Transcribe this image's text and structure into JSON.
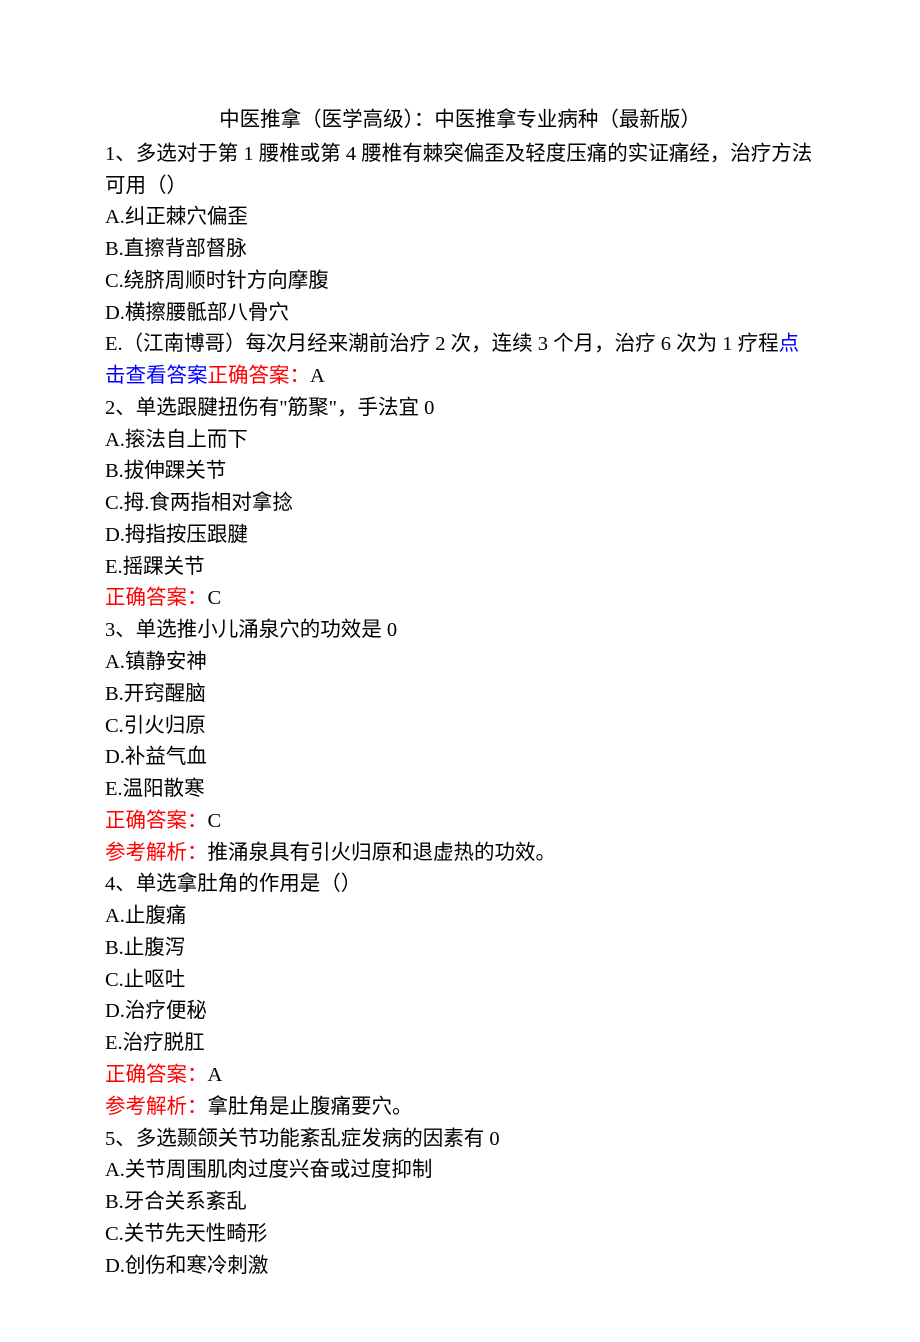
{
  "title": "中医推拿（医学高级）：中医推拿专业病种（最新版）",
  "questions": [
    {
      "stem_prefix": "1、多选",
      "stem_rest": "对于第 1 腰椎或第 4 腰椎有棘突偏歪及轻度压痛的实证痛经，治疗方法可用（）",
      "options": [
        "A.纠正棘穴偏歪",
        "B.直擦背部督脉",
        "C.绕脐周顺时针方向摩腹",
        "D.横擦腰骶部八骨穴"
      ],
      "option_e_prefix": "E.（江南博哥）每次月经来潮前治疗 2 次，连续 3 个月，治疗 6 次为 1 疗程",
      "click_label": "点击查看答案",
      "answer_label": "正确答案：",
      "answer_value": "A"
    },
    {
      "stem_prefix": "2、单选",
      "stem_rest": "跟腱扭伤有\"筋聚\"，手法宜 0",
      "options": [
        "A.㨰法自上而下",
        "B.拔伸踝关节",
        "C.拇.食两指相对拿捻",
        "D.拇指按压跟腱",
        "E.摇踝关节"
      ],
      "answer_label": "正确答案：",
      "answer_value": "C"
    },
    {
      "stem_prefix": "3、单选",
      "stem_rest": "推小儿涌泉穴的功效是 0",
      "options": [
        "A.镇静安神",
        "B.开窍醒脑",
        "C.引火归原",
        "D.补益气血",
        "E.温阳散寒"
      ],
      "answer_label": "正确答案：",
      "answer_value": "C",
      "explain_label": "参考解析：",
      "explain_value": "推涌泉具有引火归原和退虚热的功效。"
    },
    {
      "stem_prefix": "4、单选",
      "stem_rest": "拿肚角的作用是（）",
      "options": [
        "A.止腹痛",
        "B.止腹泻",
        "C.止呕吐",
        "D.治疗便秘",
        "E.治疗脱肛"
      ],
      "answer_label": "正确答案：",
      "answer_value": "A",
      "explain_label": "参考解析：",
      "explain_value": "拿肚角是止腹痛要穴。"
    },
    {
      "stem_prefix": "5、多选",
      "stem_rest": "颞颌关节功能紊乱症发病的因素有 0",
      "options": [
        "A.关节周围肌肉过度兴奋或过度抑制",
        "B.牙合关系紊乱",
        "C.关节先天性畸形",
        "D.创伤和寒冷刺激"
      ]
    }
  ]
}
